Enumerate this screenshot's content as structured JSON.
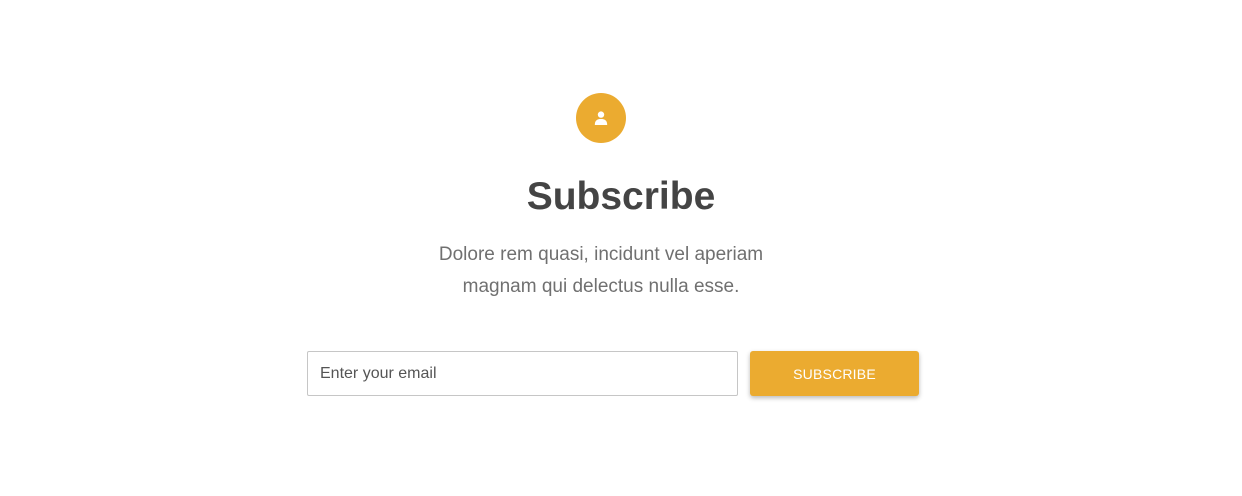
{
  "colors": {
    "accent": "#ebab30",
    "heading": "#444444",
    "text": "#707070",
    "button_text": "#ffffff"
  },
  "subscribe_section": {
    "icon": "user-icon",
    "title": "Subscribe",
    "description": "Dolore rem quasi, incidunt vel aperiam magnam qui delectus nulla esse.",
    "email_input": {
      "placeholder": "Enter your email",
      "value": ""
    },
    "button_label": "SUBSCRIBE"
  }
}
